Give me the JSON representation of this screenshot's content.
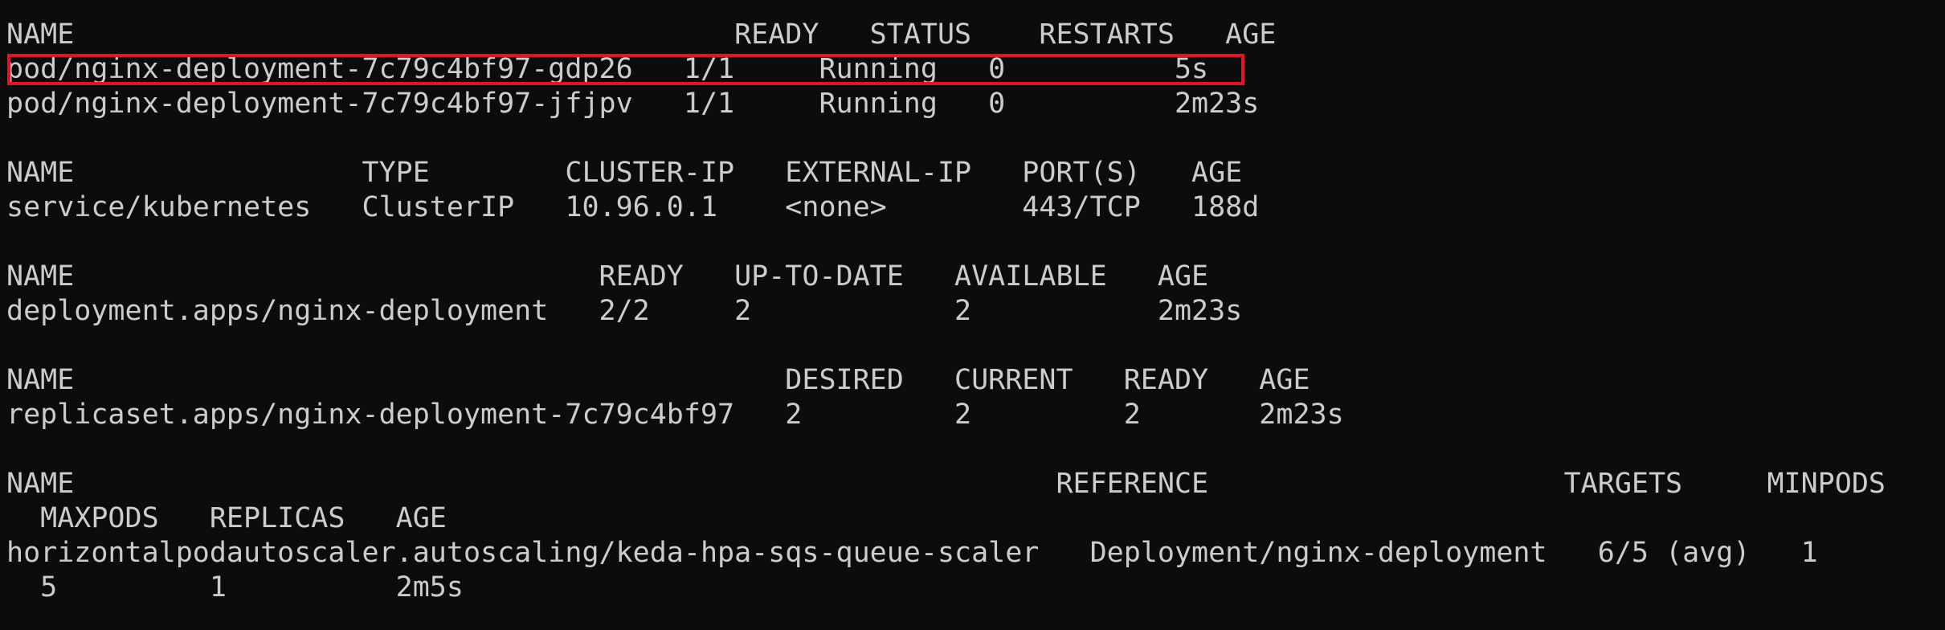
{
  "terminal": {
    "lines": [
      "NAME                                       READY   STATUS    RESTARTS   AGE",
      "pod/nginx-deployment-7c79c4bf97-gdp26   1/1     Running   0          5s",
      "pod/nginx-deployment-7c79c4bf97-jfjpv   1/1     Running   0          2m23s",
      "",
      "NAME                 TYPE        CLUSTER-IP   EXTERNAL-IP   PORT(S)   AGE",
      "service/kubernetes   ClusterIP   10.96.0.1    <none>        443/TCP   188d",
      "",
      "NAME                               READY   UP-TO-DATE   AVAILABLE   AGE",
      "deployment.apps/nginx-deployment   2/2     2            2           2m23s",
      "",
      "NAME                                          DESIRED   CURRENT   READY   AGE",
      "replicaset.apps/nginx-deployment-7c79c4bf97   2         2         2       2m23s",
      "",
      "NAME                                                          REFERENCE                     TARGETS     MINPODS",
      "  MAXPODS   REPLICAS   AGE",
      "horizontalpodautoscaler.autoscaling/keda-hpa-sqs-queue-scaler   Deployment/nginx-deployment   6/5 (avg)   1",
      "  5         1          2m5s"
    ],
    "highlight_color": "#e81123",
    "text_color": "#cccccc",
    "background_color": "#0c0c0c"
  }
}
